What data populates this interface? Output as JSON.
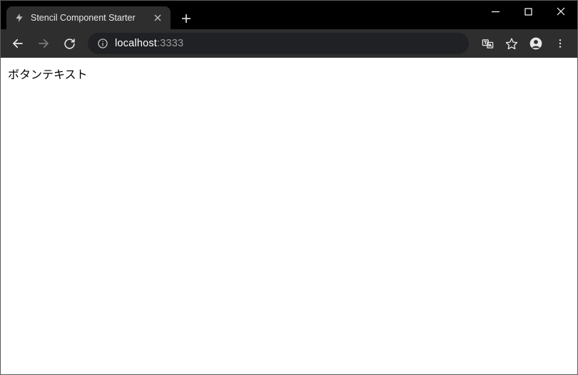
{
  "window": {
    "tab_title": "Stencil Component Starter"
  },
  "address": {
    "host": "localhost",
    "port_suffix": ":3333"
  },
  "page": {
    "body_text": "ボタンテキスト"
  }
}
